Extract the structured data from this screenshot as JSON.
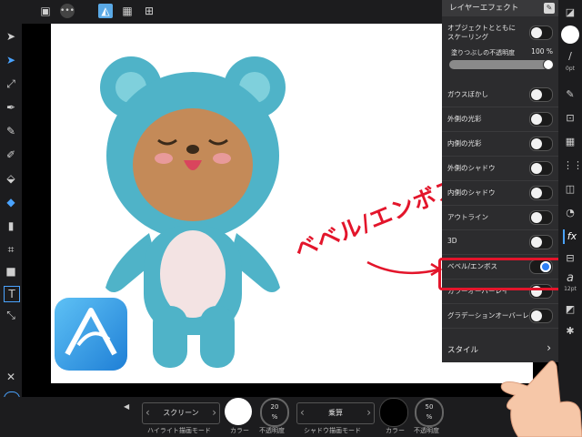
{
  "topbar": {
    "icons": [
      "document-icon",
      "more-icon",
      "affinity-persona-icon",
      "grid-icon",
      "export-icon"
    ]
  },
  "panel": {
    "title": "レイヤーエフェクト",
    "scale_label_line1": "オブジェクトとともに",
    "scale_label_line2": "スケーリング",
    "fill_opacity_label": "塗りつぶしの不透明度",
    "fill_opacity_value": "100 %",
    "fill_opacity_fraction": 1.0,
    "effects": [
      {
        "label": "ガウスぼかし",
        "on": false
      },
      {
        "label": "外側の光彩",
        "on": false
      },
      {
        "label": "内側の光彩",
        "on": false
      },
      {
        "label": "外側のシャドウ",
        "on": false
      },
      {
        "label": "内側のシャドウ",
        "on": false
      },
      {
        "label": "アウトライン",
        "on": false
      },
      {
        "label": "3D",
        "on": false
      },
      {
        "label": "ベベル/エンボス",
        "on": true
      },
      {
        "label": "カラーオーバーレイ",
        "on": false
      },
      {
        "label": "グラデーションオーバーレイ",
        "on": false
      }
    ],
    "style_label": "スタイル"
  },
  "rightrail": {
    "brush_size": "0pt",
    "font_size": "12pt"
  },
  "annotation": {
    "text": "ベベル/エンボス"
  },
  "bottom": {
    "highlight_mode": "スクリーン",
    "highlight_mode_label": "ハイライト描画モード",
    "highlight_color_label": "カラー",
    "highlight_color": "#ffffff",
    "highlight_opacity": "20",
    "highlight_opacity_unit": "%",
    "highlight_opacity_label": "不透明度",
    "shadow_mode": "乗算",
    "shadow_mode_label": "シャドウ描画モード",
    "shadow_color_label": "カラー",
    "shadow_color": "#000000",
    "shadow_opacity": "50",
    "shadow_opacity_unit": "%",
    "shadow_opacity_label": "不透明度"
  }
}
